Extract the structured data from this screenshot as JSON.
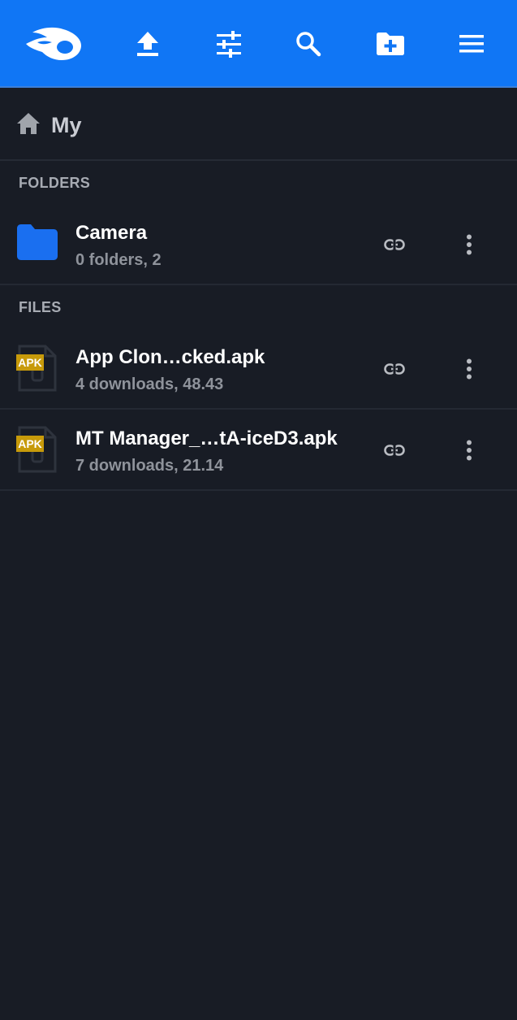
{
  "toolbar": {
    "background": "#1076f5",
    "icons": [
      "mediafire-logo-icon",
      "upload-icon",
      "filter-sliders-icon",
      "search-icon",
      "new-folder-icon",
      "menu-icon"
    ]
  },
  "breadcrumb": {
    "home_icon": "home-icon",
    "label": "My"
  },
  "sections": {
    "folders_label": "FOLDERS",
    "files_label": "FILES"
  },
  "folders": [
    {
      "name": "Camera",
      "meta": "0 folders, 2",
      "icon": "folder-icon",
      "icon_color": "#1a6ff0"
    }
  ],
  "files": [
    {
      "name": "App Clon…cked.apk",
      "meta": "4 downloads, 48.43",
      "badge": "APK",
      "icon": "apk-file-icon"
    },
    {
      "name": "MT Manager_…tA-iceD3.apk",
      "meta": "7 downloads, 21.14",
      "badge": "APK",
      "icon": "apk-file-icon"
    }
  ],
  "colors": {
    "background": "#181c25",
    "accent": "#1076f5",
    "apk_badge": "#c79a0a"
  }
}
